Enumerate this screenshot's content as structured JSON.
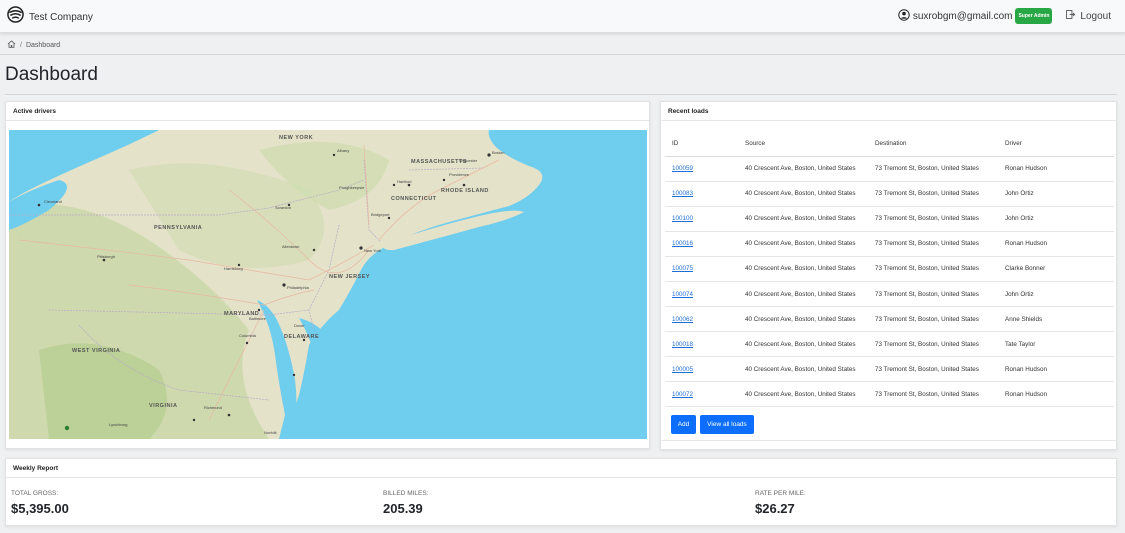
{
  "navbar": {
    "brand": "Test Company",
    "user_email": "suxrobgm@gmail.com",
    "role_badge": "Super Admin",
    "logout_label": "Logout"
  },
  "breadcrumb": {
    "separator": "/",
    "current": "Dashboard"
  },
  "page_title": "Dashboard",
  "active_drivers": {
    "title": "Active drivers",
    "map_labels": {
      "new_york_state": "NEW YORK",
      "massachusetts": "MASSACHUSETTS",
      "connecticut": "CONNECTICUT",
      "rhode_island": "RHODE ISLAND",
      "pennsylvania": "PENNSYLVANIA",
      "new_jersey": "NEW JERSEY",
      "maryland": "MARYLAND",
      "delaware": "DELAWARE",
      "west_virginia": "WEST VIRGINIA",
      "virginia": "VIRGINIA",
      "new_york_city": "New York",
      "boston": "Boston",
      "philadelphia": "Philadelphia",
      "pittsburgh": "Pittsburgh",
      "hartford": "Hartford",
      "providence": "Providence",
      "richmond": "Richmond",
      "cleveland": "Cleveland",
      "harrisburg": "Harrisburg",
      "scranton": "Scranton",
      "allentown": "Allentown",
      "norfolk": "Norfolk",
      "baltimore": "Baltimore",
      "worcester": "Worcester",
      "bridgeport": "Bridgeport",
      "poughkeepsie": "Poughkeepsie",
      "albany": "Albany",
      "lynchburg": "Lynchburg",
      "columbia": "Columbia",
      "dover": "Dover"
    }
  },
  "recent_loads": {
    "title": "Recent loads",
    "columns": [
      "ID",
      "Source",
      "Destination",
      "Driver"
    ],
    "rows": [
      {
        "id": "100059",
        "source": "40 Crescent Ave, Boston, United States",
        "destination": "73 Tremont St, Boston, United States",
        "driver": "Ronan Hudson"
      },
      {
        "id": "100083",
        "source": "40 Crescent Ave, Boston, United States",
        "destination": "73 Tremont St, Boston, United States",
        "driver": "John Ortiz"
      },
      {
        "id": "100100",
        "source": "40 Crescent Ave, Boston, United States",
        "destination": "73 Tremont St, Boston, United States",
        "driver": "John Ortiz"
      },
      {
        "id": "100016",
        "source": "40 Crescent Ave, Boston, United States",
        "destination": "73 Tremont St, Boston, United States",
        "driver": "Ronan Hudson"
      },
      {
        "id": "100075",
        "source": "40 Crescent Ave, Boston, United States",
        "destination": "73 Tremont St, Boston, United States",
        "driver": "Clarke Bonner"
      },
      {
        "id": "100074",
        "source": "40 Crescent Ave, Boston, United States",
        "destination": "73 Tremont St, Boston, United States",
        "driver": "John Ortiz"
      },
      {
        "id": "100062",
        "source": "40 Crescent Ave, Boston, United States",
        "destination": "73 Tremont St, Boston, United States",
        "driver": "Anne Shields"
      },
      {
        "id": "100018",
        "source": "40 Crescent Ave, Boston, United States",
        "destination": "73 Tremont St, Boston, United States",
        "driver": "Tate Taylor"
      },
      {
        "id": "100005",
        "source": "40 Crescent Ave, Boston, United States",
        "destination": "73 Tremont St, Boston, United States",
        "driver": "Ronan Hudson"
      },
      {
        "id": "100072",
        "source": "40 Crescent Ave, Boston, United States",
        "destination": "73 Tremont St, Boston, United States",
        "driver": "Ronan Hudson"
      }
    ],
    "add_label": "Add",
    "view_all_label": "View all loads"
  },
  "weekly_report": {
    "title": "Weekly Report",
    "total_gross_label": "TOTAL GROSS:",
    "total_gross_value": "$5,395.00",
    "billed_miles_label": "BILLED MILES:",
    "billed_miles_value": "205.39",
    "rate_per_mile_label": "RATE PER MILE:",
    "rate_per_mile_value": "$26.27"
  },
  "colors": {
    "primary": "#0d6efd",
    "badge_green": "#28a745",
    "link": "#1e6fd9",
    "water": "#6fcdee",
    "land": "#e7e3cc"
  }
}
